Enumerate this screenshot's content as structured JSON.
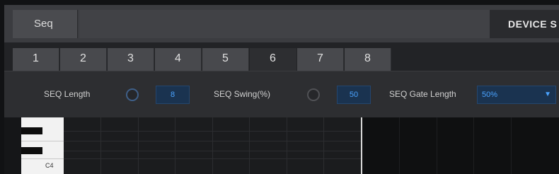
{
  "header": {
    "seq_tab_label": "Seq",
    "device_tab_label": "DEVICE S"
  },
  "tabs": [
    "1",
    "2",
    "3",
    "4",
    "5",
    "6",
    "7",
    "8"
  ],
  "active_tab": "6",
  "controls": {
    "seq_length_label": "SEQ Length",
    "seq_length_value": "8",
    "seq_swing_label": "SEQ Swing(%)",
    "seq_swing_value": "50",
    "seq_gate_length_label": "SEQ Gate Length",
    "seq_gate_length_value": "50%"
  },
  "piano_roll": {
    "note_label": "C4"
  },
  "colors": {
    "accent": "#4aa3ff",
    "value_box_bg": "#1a3350"
  },
  "icons": {
    "dropdown_caret": "caret-down-icon"
  }
}
